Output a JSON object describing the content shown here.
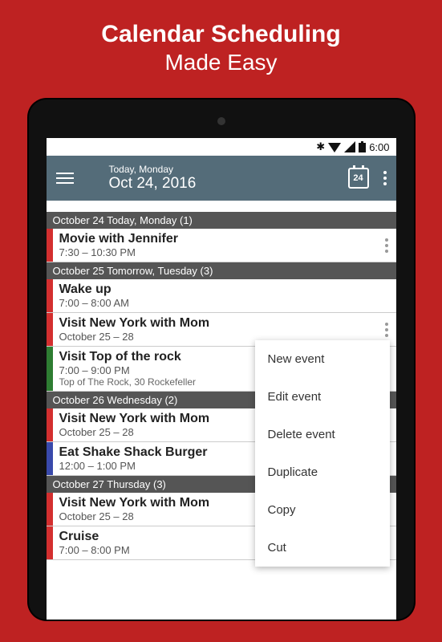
{
  "promo": {
    "line1": "Calendar Scheduling",
    "line2": "Made Easy"
  },
  "statusbar": {
    "time": "6:00"
  },
  "appbar": {
    "small": "Today, Monday",
    "large": "Oct 24, 2016",
    "calDay": "24"
  },
  "sections": [
    {
      "header": "October 24 Today, Monday (1)",
      "events": [
        {
          "color": "#D32F2F",
          "title": "Movie with Jennifer",
          "time": "7:30 – 10:30 PM",
          "dots": true
        }
      ]
    },
    {
      "header": "October 25 Tomorrow, Tuesday (3)",
      "events": [
        {
          "color": "#D32F2F",
          "title": "Wake up",
          "time": "7:00 – 8:00 AM"
        },
        {
          "color": "#D32F2F",
          "title": "Visit New York with Mom",
          "time": "October 25 – 28",
          "dots": true
        },
        {
          "color": "#2E7D32",
          "title": "Visit Top of the rock",
          "time": "7:00 – 9:00 PM",
          "loc": "Top of The Rock, 30 Rockefeller"
        }
      ]
    },
    {
      "header": "October 26 Wednesday (2)",
      "events": [
        {
          "color": "#D32F2F",
          "title": "Visit New York with Mom",
          "time": "October 25 – 28"
        },
        {
          "color": "#3949AB",
          "title": "Eat Shake Shack Burger",
          "time": "12:00 – 1:00 PM"
        }
      ]
    },
    {
      "header": "October 27 Thursday (3)",
      "events": [
        {
          "color": "#D32F2F",
          "title": "Visit New York with Mom",
          "time": "October 25 – 28"
        },
        {
          "color": "#D32F2F",
          "title": "Cruise",
          "time": "7:00 – 8:00 PM"
        }
      ]
    }
  ],
  "contextMenu": [
    "New event",
    "Edit event",
    "Delete event",
    "Duplicate",
    "Copy",
    "Cut"
  ]
}
